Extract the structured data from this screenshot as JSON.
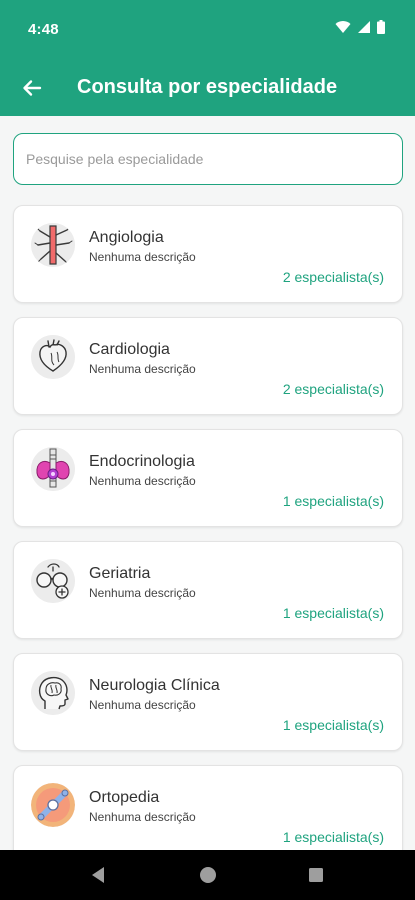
{
  "status_bar": {
    "time": "4:48"
  },
  "app_bar": {
    "title": "Consulta por especialidade"
  },
  "search": {
    "placeholder": "Pesquise pela especialidade",
    "value": ""
  },
  "specialties": [
    {
      "name": "Angiologia",
      "description": "Nenhuma descrição",
      "count": "2 especialista(s)",
      "icon": "blood-vessels-icon"
    },
    {
      "name": "Cardiologia",
      "description": "Nenhuma descrição",
      "count": "2 especialista(s)",
      "icon": "heart-icon"
    },
    {
      "name": "Endocrinologia",
      "description": "Nenhuma descrição",
      "count": "1 especialista(s)",
      "icon": "thyroid-icon"
    },
    {
      "name": "Geriatria",
      "description": "Nenhuma descrição",
      "count": "1 especialista(s)",
      "icon": "elderly-glasses-icon"
    },
    {
      "name": "Neurologia Clínica",
      "description": "Nenhuma descrição",
      "count": "1 especialista(s)",
      "icon": "head-brain-icon"
    },
    {
      "name": "Ortopedia",
      "description": "Nenhuma descrição",
      "count": "1 especialista(s)",
      "icon": "bone-joint-icon"
    }
  ],
  "colors": {
    "primary": "#1fa37f",
    "background": "#f5f6f6",
    "card": "#ffffff",
    "nav_bar": "#000000"
  },
  "nav_bar": {
    "back": "back-triangle-icon",
    "home": "home-circle-icon",
    "recents": "recents-square-icon"
  }
}
